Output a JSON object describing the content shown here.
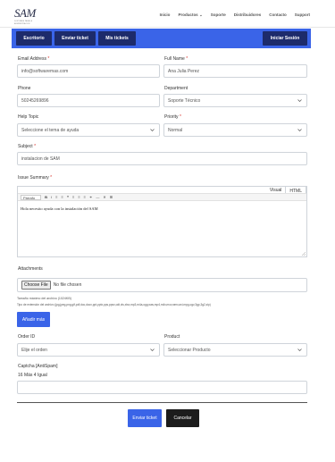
{
  "header": {
    "logo_text": "SAM",
    "logo_subtext": "SOFTWARE PARA LA ADMINISTRACION",
    "nav": [
      "Inicio",
      "Productos ⌄",
      "Soporte",
      "Distribuidores",
      "Contacto",
      "Support"
    ]
  },
  "toolbar": {
    "escritorio": "Escritorio",
    "enviar_ticket": "Enviar ticket",
    "mis_tickets": "Mis tickets",
    "iniciar_sesion": "Iniciar Sesión",
    "colors": {
      "bar": "#3a64e8",
      "button": "#1d2b6b"
    }
  },
  "form": {
    "email": {
      "label": "Email Address",
      "value": "info@softwaremas.com"
    },
    "full_name": {
      "label": "Full Name",
      "value": "Ana Julia Perez"
    },
    "phone": {
      "label": "Phone",
      "value": "50245269896"
    },
    "department": {
      "label": "Department",
      "value": "Soporte Técnico"
    },
    "help_topic": {
      "label": "Help Topic",
      "value": "Seleccione el tema de ayuda"
    },
    "priority": {
      "label": "Priority",
      "value": "Normal"
    },
    "subject": {
      "label": "Subject",
      "value": "instalacion de SAM"
    },
    "issue_summary": {
      "label": "Issue Summary",
      "tabs": [
        "Visual",
        "HTML"
      ],
      "format_select": "Párrafo",
      "toolbar_icons": [
        "B",
        "I",
        "≡",
        "≡",
        "❝",
        "≡",
        "≡",
        "≡",
        "⚭",
        "—",
        "✕",
        "⊞"
      ],
      "body": "Hola necesito ayuda con la instalación del SAM"
    },
    "attachments": {
      "label": "Attachments",
      "choose_file": "Choose File",
      "no_file": "No file chosen",
      "max_size": "Tamaño máximo del archivo (1024KB)",
      "extensions": "Tipo de extensión del archivo (jpg,jpeg,png,gif,pdf,doc,docx,ppt,pptx,pps,ppsx,odt,xls,xlsx,mp3,m4a,ogg,wav,mp4,m4v,mov,wmv,avi,mpg,ogv,3gp,3g2,zip)",
      "add_more": "Añadir más"
    },
    "order_id": {
      "label": "Order ID",
      "value": "Elije el orden"
    },
    "product": {
      "label": "Product",
      "value": "Seleccionar Producto"
    },
    "captcha": {
      "label": "Captcha [AntiSpam]",
      "question": "16 Más 4 Igual",
      "value": ""
    },
    "required_mark": "*"
  },
  "actions": {
    "submit": "Enviar ticket",
    "cancel": "Cancelar"
  }
}
